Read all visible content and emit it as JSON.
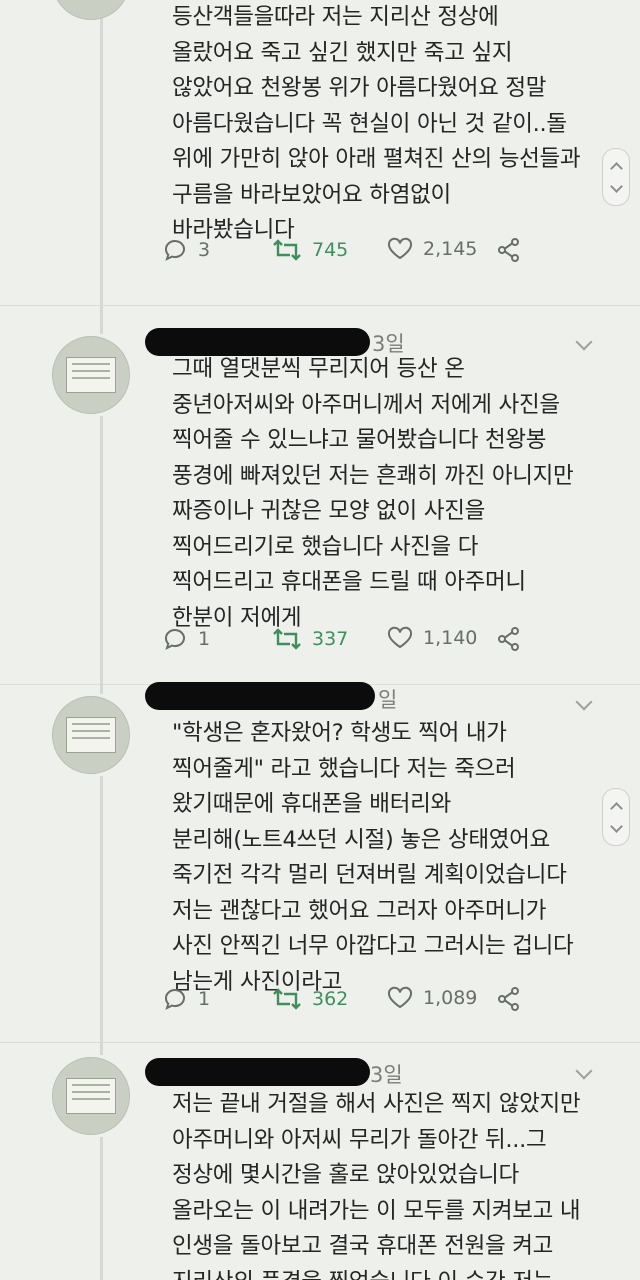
{
  "tweets": [
    {
      "time": "",
      "text": "등산객들을따라 저는 지리산 정상에\n올랐어요 죽고 싶긴 했지만 죽고 싶지\n않았어요 천왕봉 위가 아름다웠어요 정말\n아름다웠습니다 꼭 현실이 아닌 것 같이..돌\n위에 가만히 앉아 아래 펼쳐진 산의 능선들과\n구름을 바라보았어요 하염없이\n바라봤습니다",
      "replies": "3",
      "retweets": "745",
      "likes": "2,145"
    },
    {
      "time": "3일",
      "text": "그때 열댓분씩 무리지어 등산 온\n중년아저씨와 아주머니께서 저에게 사진을\n찍어줄 수 있느냐고 물어봤습니다 천왕봉\n풍경에 빠져있던 저는 흔쾌히 까진 아니지만\n짜증이나 귀찮은 모양 없이 사진을\n찍어드리기로 했습니다 사진을 다\n찍어드리고 휴대폰을 드릴 때 아주머니\n한분이 저에게",
      "replies": "1",
      "retweets": "337",
      "likes": "1,140"
    },
    {
      "time": "일",
      "text": "\"학생은 혼자왔어? 학생도 찍어 내가\n찍어줄게\" 라고 했습니다 저는 죽으러\n왔기때문에 휴대폰을 배터리와\n분리해(노트4쓰던 시절) 놓은 상태였어요\n죽기전 각각 멀리 던져버릴 계획이었습니다\n저는 괜찮다고 했어요 그러자 아주머니가\n사진 안찍긴 너무 아깝다고 그러시는 겁니다\n남는게 사진이라고",
      "replies": "1",
      "retweets": "362",
      "likes": "1,089"
    },
    {
      "time": "3일",
      "text": "저는 끝내 거절을 해서 사진은 찍지 않았지만\n아주머니와 아저씨 무리가 돌아간 뒤...그\n정상에 몇시간을 홀로 앉아있었습니다\n올라오는 이 내려가는 이 모두를 지켜보고 내\n인생을 돌아보고 결국 휴대폰 전원을 켜고\n지리산의 풍경을 찍었습니다 이 순간 저는",
      "replies": "",
      "retweets": "",
      "likes": ""
    }
  ],
  "icons": {
    "reply": "reply-icon",
    "retweet": "retweet-icon",
    "like": "heart-icon",
    "share": "share-icon",
    "more": "chevron-down-icon",
    "scroll": "scroll-tab-icon"
  },
  "colors": {
    "background": "#eef0ec",
    "retweet_green": "#3f8f5a",
    "action_gray": "#667066",
    "redaction": "#0c0c0c"
  }
}
